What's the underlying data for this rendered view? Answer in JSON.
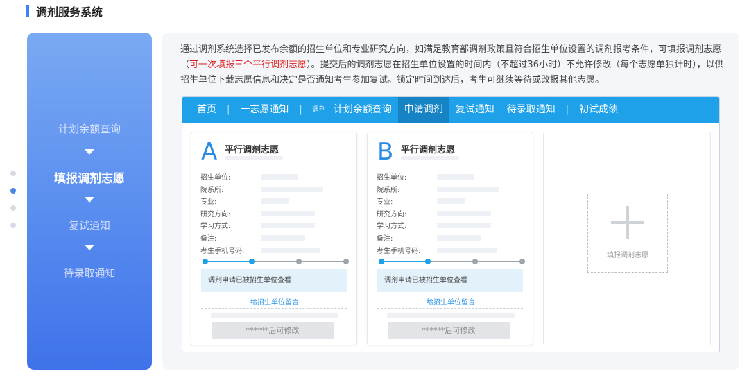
{
  "section_title": "调剂服务系统",
  "steps": [
    {
      "label": "计划余额查询",
      "active": false
    },
    {
      "label": "填报调剂志愿",
      "active": true
    },
    {
      "label": "复试通知",
      "active": false
    },
    {
      "label": "待录取通知",
      "active": false
    }
  ],
  "description": {
    "part1": "通过调剂系统选择已发布余额的招生单位和专业研究方向，如满足教育部调剂政策且符合招生单位设置的调剂报考条件，可填报调剂志愿（",
    "highlight": "可一次填报三个平行调剂志愿",
    "part2": "）。提交后的调剂志愿在招生单位设置的时间内（不超过36小时）不允许修改（每个志愿单独计时），以供招生单位下载志愿信息和决定是否通知考生参加复试。锁定时间到达后，考生可继续等待或改报其他志愿。"
  },
  "nav": {
    "home": "首页",
    "first_choice": "一志愿通知",
    "small_tag": "调剂",
    "plan_query": "计划余额查询",
    "apply": "申请调剂",
    "retest": "复试通知",
    "admission": "待录取通知",
    "scores": "初试成绩"
  },
  "cards": [
    {
      "letter": "A",
      "title": "平行调剂志愿",
      "fields": [
        "招生单位:",
        "院系所:",
        "专业:",
        "研究方向:",
        "学习方式:",
        "备注:",
        "考生手机号码:"
      ],
      "status": "调剂申请已被招生单位查看",
      "message_link": "给招生单位留言",
      "modify_button": "******后可修改",
      "progress": 0.33
    },
    {
      "letter": "B",
      "title": "平行调剂志愿",
      "fields": [
        "招生单位:",
        "院系所:",
        "专业:",
        "研究方向:",
        "学习方式:",
        "备注:",
        "考生手机号码:"
      ],
      "status": "调剂申请已被招生单位查看",
      "message_link": "给招生单位留言",
      "modify_button": "******后可修改",
      "progress": 0.33
    }
  ],
  "add_card": {
    "label": "填报调剂志愿"
  },
  "colors": {
    "accent": "#1ea1e8",
    "highlight": "#e02020",
    "step_gradient_top": "#7aa9f3",
    "step_gradient_bottom": "#3f72ea"
  }
}
